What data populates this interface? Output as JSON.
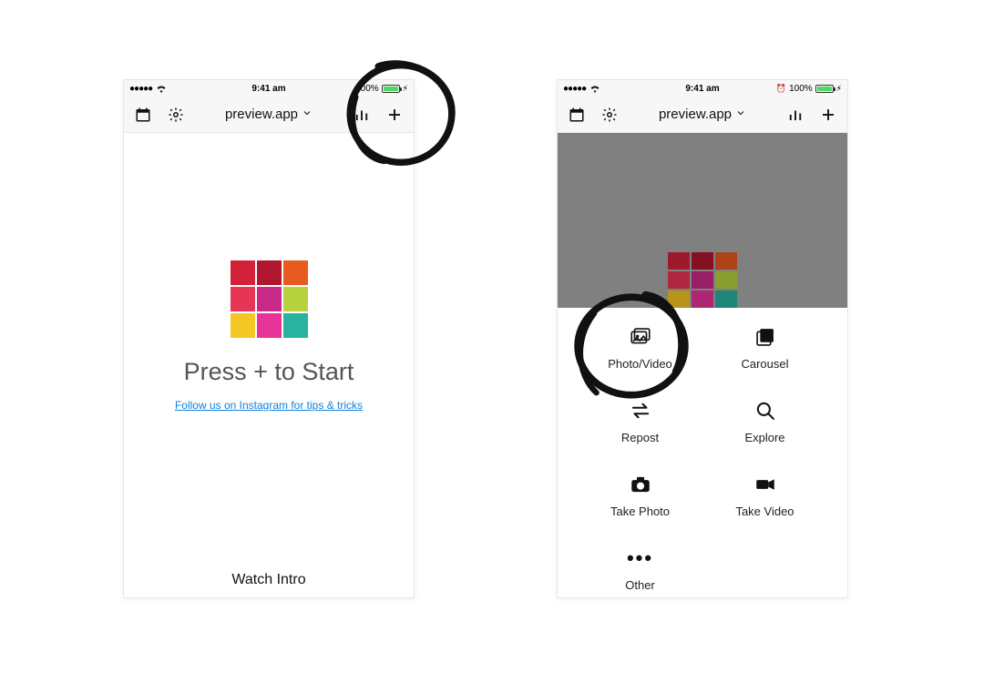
{
  "status": {
    "time": "9:41 am",
    "battery_text": "100%"
  },
  "nav": {
    "title": "preview.app"
  },
  "left_screen": {
    "headline": "Press + to Start",
    "sublink": "Follow us on Instagram for tips & tricks",
    "watch_intro": "Watch Intro"
  },
  "right_screen": {
    "options": {
      "photo_video": "Photo/Video",
      "carousel": "Carousel",
      "repost": "Repost",
      "explore": "Explore",
      "take_photo": "Take Photo",
      "take_video": "Take Video",
      "other": "Other"
    }
  }
}
